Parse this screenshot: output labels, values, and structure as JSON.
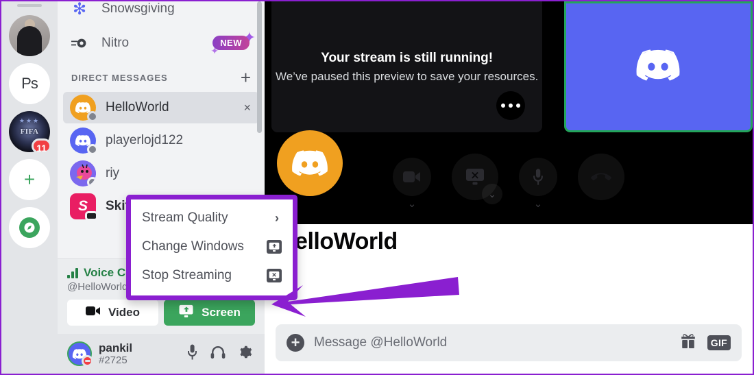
{
  "server_rail": {
    "items": [
      {
        "name": "user-avatar-server",
        "label": "",
        "type": "photo"
      },
      {
        "name": "server-ps",
        "label": "Ps",
        "type": "text"
      },
      {
        "name": "server-fifa",
        "label": "FIFA",
        "type": "image",
        "badge": "11"
      },
      {
        "name": "add-server",
        "label": "+",
        "type": "action"
      },
      {
        "name": "explore-servers",
        "label": "",
        "type": "compass"
      }
    ]
  },
  "sidebar": {
    "nav": [
      {
        "label": "Snowsgiving",
        "icon": "snowflake-icon"
      },
      {
        "label": "Nitro",
        "icon": "nitro-icon",
        "badge": "NEW"
      }
    ],
    "dm_header": {
      "title": "DIRECT MESSAGES",
      "add_label": "+"
    },
    "dms": [
      {
        "name": "HelloWorld",
        "active": true,
        "avatar_color": "#f0a020",
        "status": "offline",
        "close": "×"
      },
      {
        "name": "playerlojd122",
        "active": false,
        "avatar_color": "#5865f2",
        "status": "offline"
      },
      {
        "name": "riy",
        "active": false,
        "avatar_color": "#7b68ee",
        "status": "offline"
      },
      {
        "name": "Skito",
        "active": false,
        "avatar_color": "#e91e63",
        "status": "video"
      }
    ],
    "voice": {
      "title": "Voice Co",
      "subtitle": "@HelloWorld",
      "video_button": "Video",
      "screen_button": "Screen"
    },
    "user": {
      "username": "pankil",
      "tag": "#2725",
      "icons": [
        "microphone-icon",
        "headphones-icon",
        "settings-gear-icon"
      ]
    }
  },
  "call": {
    "stream_tile": {
      "heading": "Your stream is still running!",
      "subtext": "We’ve paused this preview to save your resources.",
      "more_label": "•••"
    },
    "self_tile": {
      "label": ""
    },
    "controls": [
      "video-camera-icon",
      "stop-screenshare-icon",
      "microphone-icon",
      "hangup-call-icon"
    ]
  },
  "chat": {
    "dm_title": "HelloWorld",
    "composer_placeholder": "Message @HelloWorld",
    "gif_label": "GIF",
    "icons": [
      "add-attachment-icon",
      "gift-icon",
      "gif-icon"
    ]
  },
  "context_menu": {
    "items": [
      {
        "label": "Stream Quality",
        "trailing": "›",
        "trailing_type": "chevron"
      },
      {
        "label": "Change Windows",
        "trailing": "↱",
        "trailing_type": "screen-share-icon"
      },
      {
        "label": "Stop Streaming",
        "trailing": "×",
        "trailing_type": "stop-share-icon"
      }
    ]
  },
  "annotation": {
    "border_color": "#8a1fd0",
    "arrow_color": "#8a1fd0"
  },
  "colors": {
    "brand_blurple": "#5865f2",
    "green_active": "#3ba55d",
    "speaking_green": "#23a55a",
    "danger_red": "#f23f43",
    "orange_avatar": "#f0a020"
  }
}
